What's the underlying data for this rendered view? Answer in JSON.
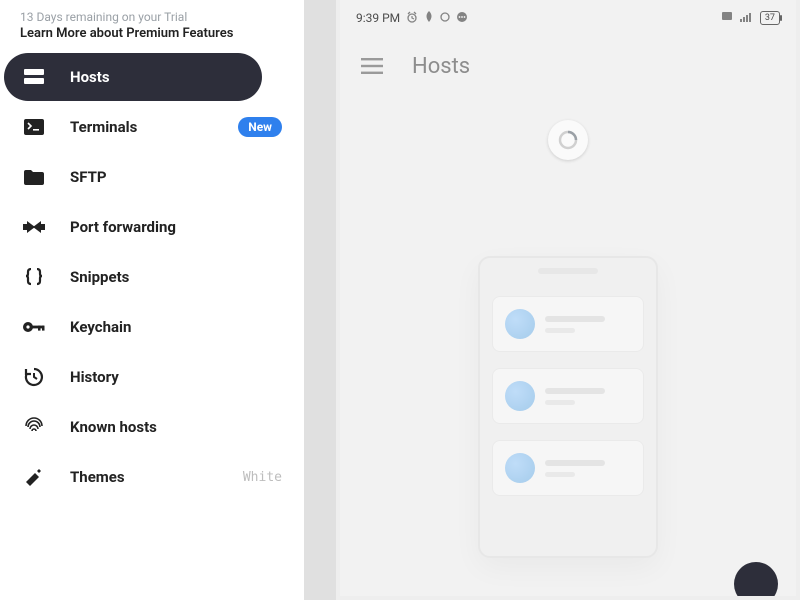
{
  "trial": {
    "days_line": "13 Days remaining on your Trial",
    "learn_more": "Learn More about Premium Features"
  },
  "sidebar": {
    "items": [
      {
        "label": "Hosts",
        "icon": "hosts-icon",
        "active": true
      },
      {
        "label": "Terminals",
        "icon": "terminals-icon",
        "badge": "New"
      },
      {
        "label": "SFTP",
        "icon": "folder-icon"
      },
      {
        "label": "Port forwarding",
        "icon": "port-forward-icon"
      },
      {
        "label": "Snippets",
        "icon": "braces-icon"
      },
      {
        "label": "Keychain",
        "icon": "key-icon"
      },
      {
        "label": "History",
        "icon": "history-icon"
      },
      {
        "label": "Known hosts",
        "icon": "fingerprint-icon"
      },
      {
        "label": "Themes",
        "icon": "themes-icon",
        "value": "White"
      }
    ]
  },
  "status_bar": {
    "time": "9:39 PM",
    "battery": "37"
  },
  "app_bar": {
    "title": "Hosts"
  }
}
